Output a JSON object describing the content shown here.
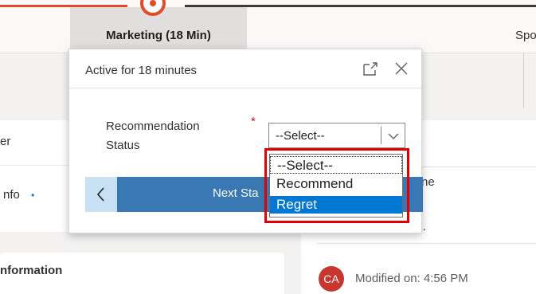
{
  "stage_bar": {
    "active_stage_label": "Marketing  (18 Min)",
    "next_stage_label": "Spo"
  },
  "background": {
    "left_label_1": "er",
    "left_label_2": "nfo",
    "left_required_mark": "•",
    "section_heading": "nformation",
    "timeline_label": "eline",
    "search_hint": "e...",
    "avatar_initials": "CA",
    "modified_text": "Modified on: 4:56 PM"
  },
  "flyout": {
    "title": "Active for 18 minutes",
    "field_label": "Recommendation Status",
    "required_mark": "*",
    "select_value": "--Select--",
    "next_stage_button": "Next Sta",
    "back_button_glyph": "<"
  },
  "dropdown": {
    "options": [
      "--Select--",
      "Recommend",
      "Regret"
    ],
    "highlighted_option": "Regret"
  },
  "colors": {
    "accent": "#0078d4",
    "stage_red": "#e14b2b",
    "highlight_red": "#e00000",
    "next_button": "#3a78b4"
  },
  "icons": [
    "expand-icon",
    "close-icon",
    "chevron-down-icon",
    "chevron-left-icon"
  ]
}
